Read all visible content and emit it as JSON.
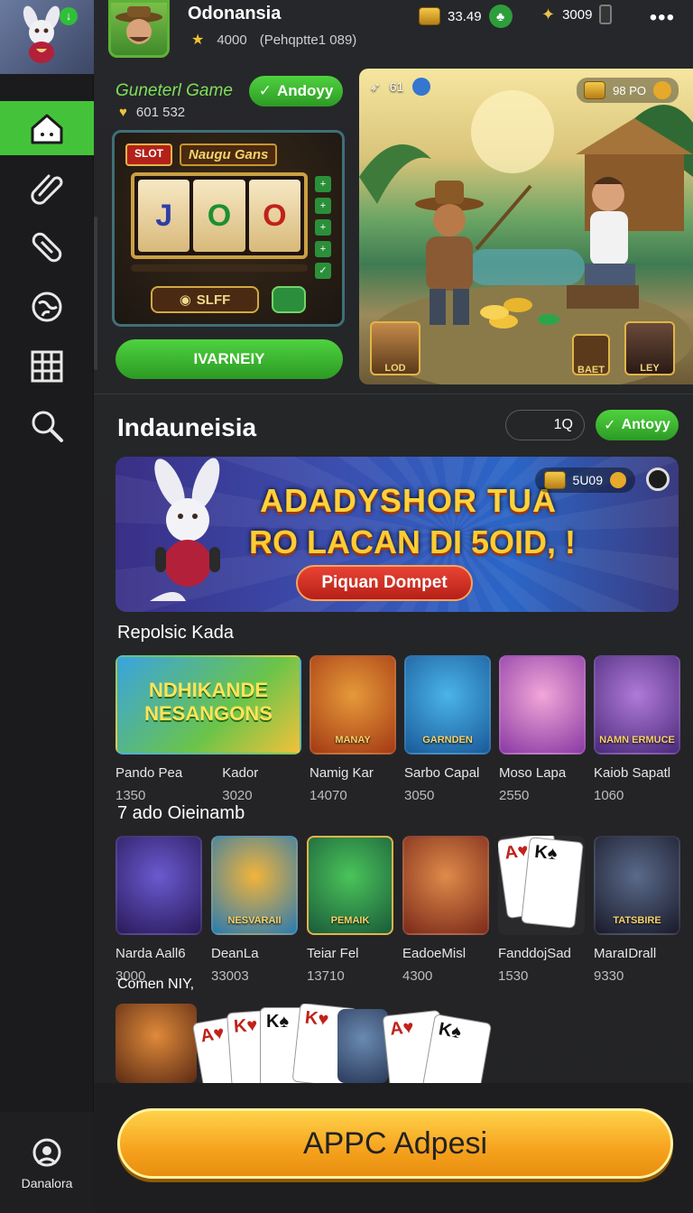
{
  "colors": {
    "accent": "#44c33a",
    "gold": "#f6a21d",
    "bg": "#232325"
  },
  "sidebar": {
    "items": [
      {
        "icon": "home-icon",
        "active": true
      },
      {
        "icon": "paperclip-icon",
        "active": false
      },
      {
        "icon": "capsule-icon",
        "active": false
      },
      {
        "icon": "globe-icon",
        "active": false
      },
      {
        "icon": "grid-icon",
        "active": false
      },
      {
        "icon": "search-icon",
        "active": false
      }
    ],
    "bottom_label": "Danalora"
  },
  "header": {
    "name": "Odonansia",
    "rating": "4000",
    "subtitle": "(Pehqptte1 089)",
    "coins": "33.49",
    "gems": "3009"
  },
  "featured": {
    "title": "Guneterl Game",
    "apply_label": "Andoyy",
    "likes": "601 532",
    "slot_tag": "SLOT",
    "slot_brand": "Naugu Gans",
    "reels": [
      "J",
      "O",
      "O"
    ],
    "bet_label": "SLFF",
    "cta_label": "IVARNEIY",
    "art_left": "61",
    "art_right": "98 PO",
    "art_badges": [
      "LOD",
      "BAET",
      "LEY"
    ]
  },
  "section": {
    "title": "Indauneisia",
    "search_value": "1Q",
    "apply_label": "Antoyy"
  },
  "banner": {
    "line1": "ADADYSHOR TUA",
    "line2": "RO LACAN DI 5OID, !",
    "button": "Piquan Dompet",
    "coins": "5U09"
  },
  "grid1": {
    "title": "Repolsic Kada",
    "tiles": [
      {
        "name": "Pando Pea",
        "value": "1350",
        "art": "NDHIKANDE NESANGONS"
      },
      {
        "name": "Kador",
        "value": "3020",
        "art": ""
      },
      {
        "name": "Namig Kar",
        "value": "14070",
        "art": "MANAY"
      },
      {
        "name": "Sarbo Capal",
        "value": "3050",
        "art": "GARNDEN"
      },
      {
        "name": "Moso Lapa",
        "value": "2550",
        "art": ""
      },
      {
        "name": "Kaiob Sapatl",
        "value": "1060",
        "art": "NAMN ERMUCE"
      }
    ]
  },
  "grid2": {
    "title": "7 ado Oieinamb",
    "tiles": [
      {
        "name": "Narda Aall6",
        "value": "3000",
        "art": ""
      },
      {
        "name": "DeanLa",
        "value": "33003",
        "art": "NESVARAII"
      },
      {
        "name": "Teiar Fel",
        "value": "13710",
        "art": "PEMAIK"
      },
      {
        "name": "EadoeMisl",
        "value": "4300",
        "art": ""
      },
      {
        "name": "FanddojSad",
        "value": "1530",
        "art": ""
      },
      {
        "name": "MaraIDrall",
        "value": "9330",
        "art": "TATSBIRE"
      }
    ]
  },
  "cards": {
    "title": "Comen NIY,"
  },
  "cta": {
    "label": "APPC Adpesi"
  }
}
